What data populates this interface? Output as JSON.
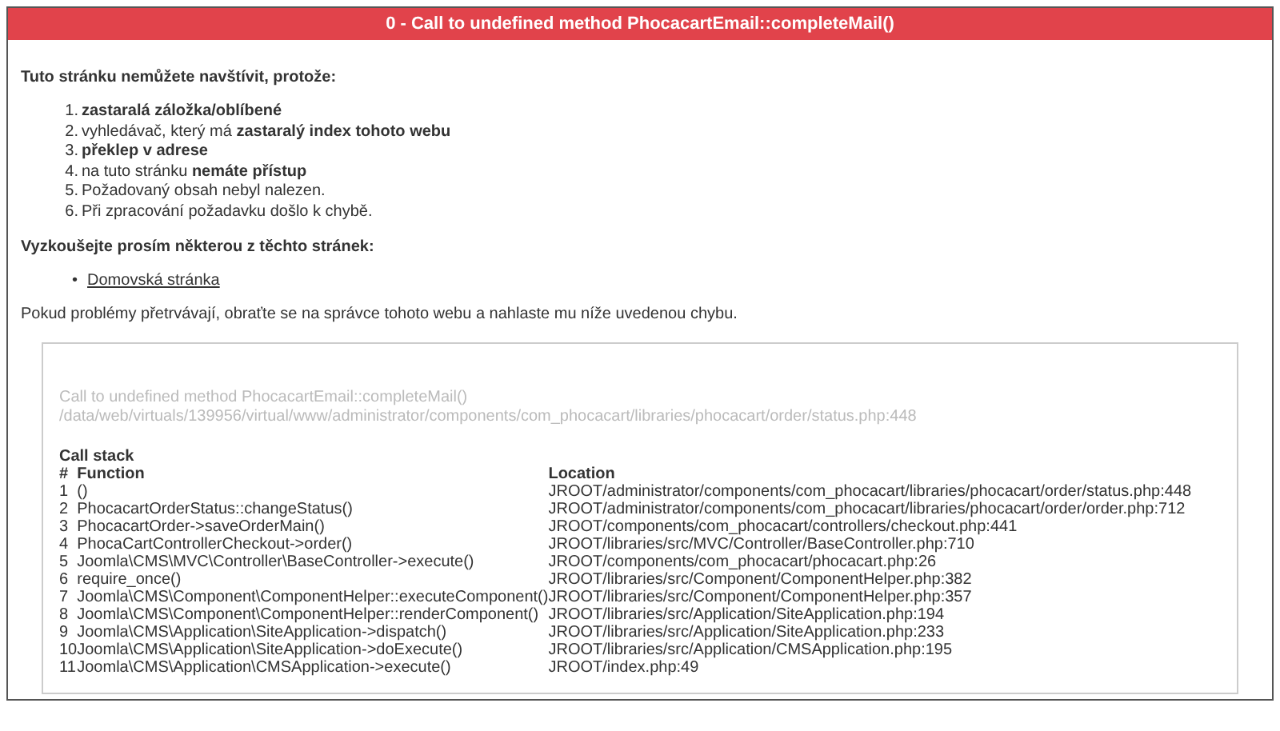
{
  "title": "0 - Call to undefined method PhocacartEmail::completeMail()",
  "intro": "Tuto stránku nemůžete navštívit, protože:",
  "reasons": [
    {
      "number": "1.",
      "text": "**zastaralá záložka/oblíbené**"
    },
    {
      "number": "2.",
      "text": "vyhledávač, který má **zastaralý index tohoto webu**"
    },
    {
      "number": "3.",
      "text": "**překlep v adrese**"
    },
    {
      "number": "4.",
      "text": "na tuto stránku **nemáte přístup**"
    },
    {
      "number": "5.",
      "text": "Požadovaný obsah nebyl nalezen."
    },
    {
      "number": "6.",
      "text": "Při zpracování požadavku došlo k chybě."
    }
  ],
  "try_heading": "Vyzkoušejte prosím některou z těchto stránek:",
  "links": [
    {
      "bullet": "•",
      "label": "Domovská stránka"
    }
  ],
  "contact": "Pokud problémy přetrvávají, obraťte se na správce tohoto webu a nahlaste mu níže uvedenou chybu.",
  "error": {
    "message": "Call to undefined method PhocacartEmail::completeMail()",
    "file": "/data/web/virtuals/139956/virtual/www/administrator/components/com_phocacart/libraries/phocacart/order/status.php:448"
  },
  "call_stack": {
    "title": "Call stack",
    "columns": [
      "#",
      "Function",
      "Location"
    ],
    "rows": [
      [
        "1",
        "()",
        "JROOT/administrator/components/com_phocacart/libraries/phocacart/order/status.php:448"
      ],
      [
        "2",
        "PhocacartOrderStatus::changeStatus()",
        "JROOT/administrator/components/com_phocacart/libraries/phocacart/order/order.php:712"
      ],
      [
        "3",
        "PhocacartOrder->saveOrderMain()",
        "JROOT/components/com_phocacart/controllers/checkout.php:441"
      ],
      [
        "4",
        "PhocaCartControllerCheckout->order()",
        "JROOT/libraries/src/MVC/Controller/BaseController.php:710"
      ],
      [
        "5",
        "Joomla\\CMS\\MVC\\Controller\\BaseController->execute()",
        "JROOT/components/com_phocacart/phocacart.php:26"
      ],
      [
        "6",
        "require_once()",
        "JROOT/libraries/src/Component/ComponentHelper.php:382"
      ],
      [
        "7",
        "Joomla\\CMS\\Component\\ComponentHelper::executeComponent()",
        "JROOT/libraries/src/Component/ComponentHelper.php:357"
      ],
      [
        "8",
        "Joomla\\CMS\\Component\\ComponentHelper::renderComponent()",
        "JROOT/libraries/src/Application/SiteApplication.php:194"
      ],
      [
        "9",
        "Joomla\\CMS\\Application\\SiteApplication->dispatch()",
        "JROOT/libraries/src/Application/SiteApplication.php:233"
      ],
      [
        "10",
        "Joomla\\CMS\\Application\\SiteApplication->doExecute()",
        "JROOT/libraries/src/Application/CMSApplication.php:195"
      ],
      [
        "11",
        "Joomla\\CMS\\Application\\CMSApplication->execute()",
        "JROOT/index.php:49"
      ]
    ]
  }
}
